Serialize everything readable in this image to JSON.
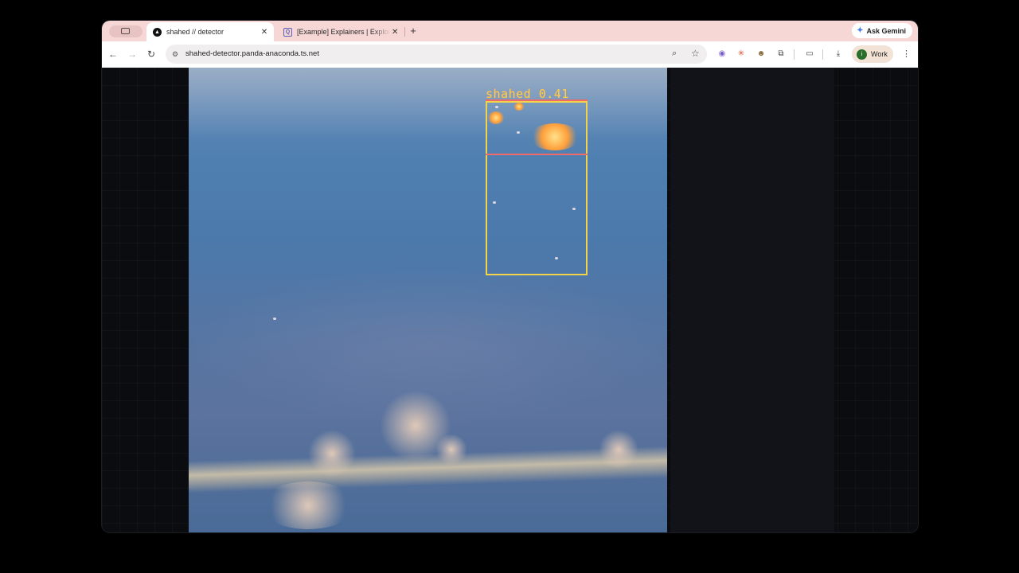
{
  "browser": {
    "tabs": [
      {
        "title": "shahed // detector",
        "favicon": "app-logo-icon",
        "active": true
      },
      {
        "title": "[Example] Explainers | Explore",
        "favicon": "search-document-icon",
        "active": false
      }
    ],
    "ask_gemini_label": "Ask Gemini",
    "url": "shahed-detector.panda-anaconda.ts.net",
    "profile": {
      "initial": "i",
      "label": "Work"
    }
  },
  "detection": {
    "label": "shahed 0.41",
    "box_color": "#f2d34a",
    "label_line_color": "#f06a6a"
  }
}
